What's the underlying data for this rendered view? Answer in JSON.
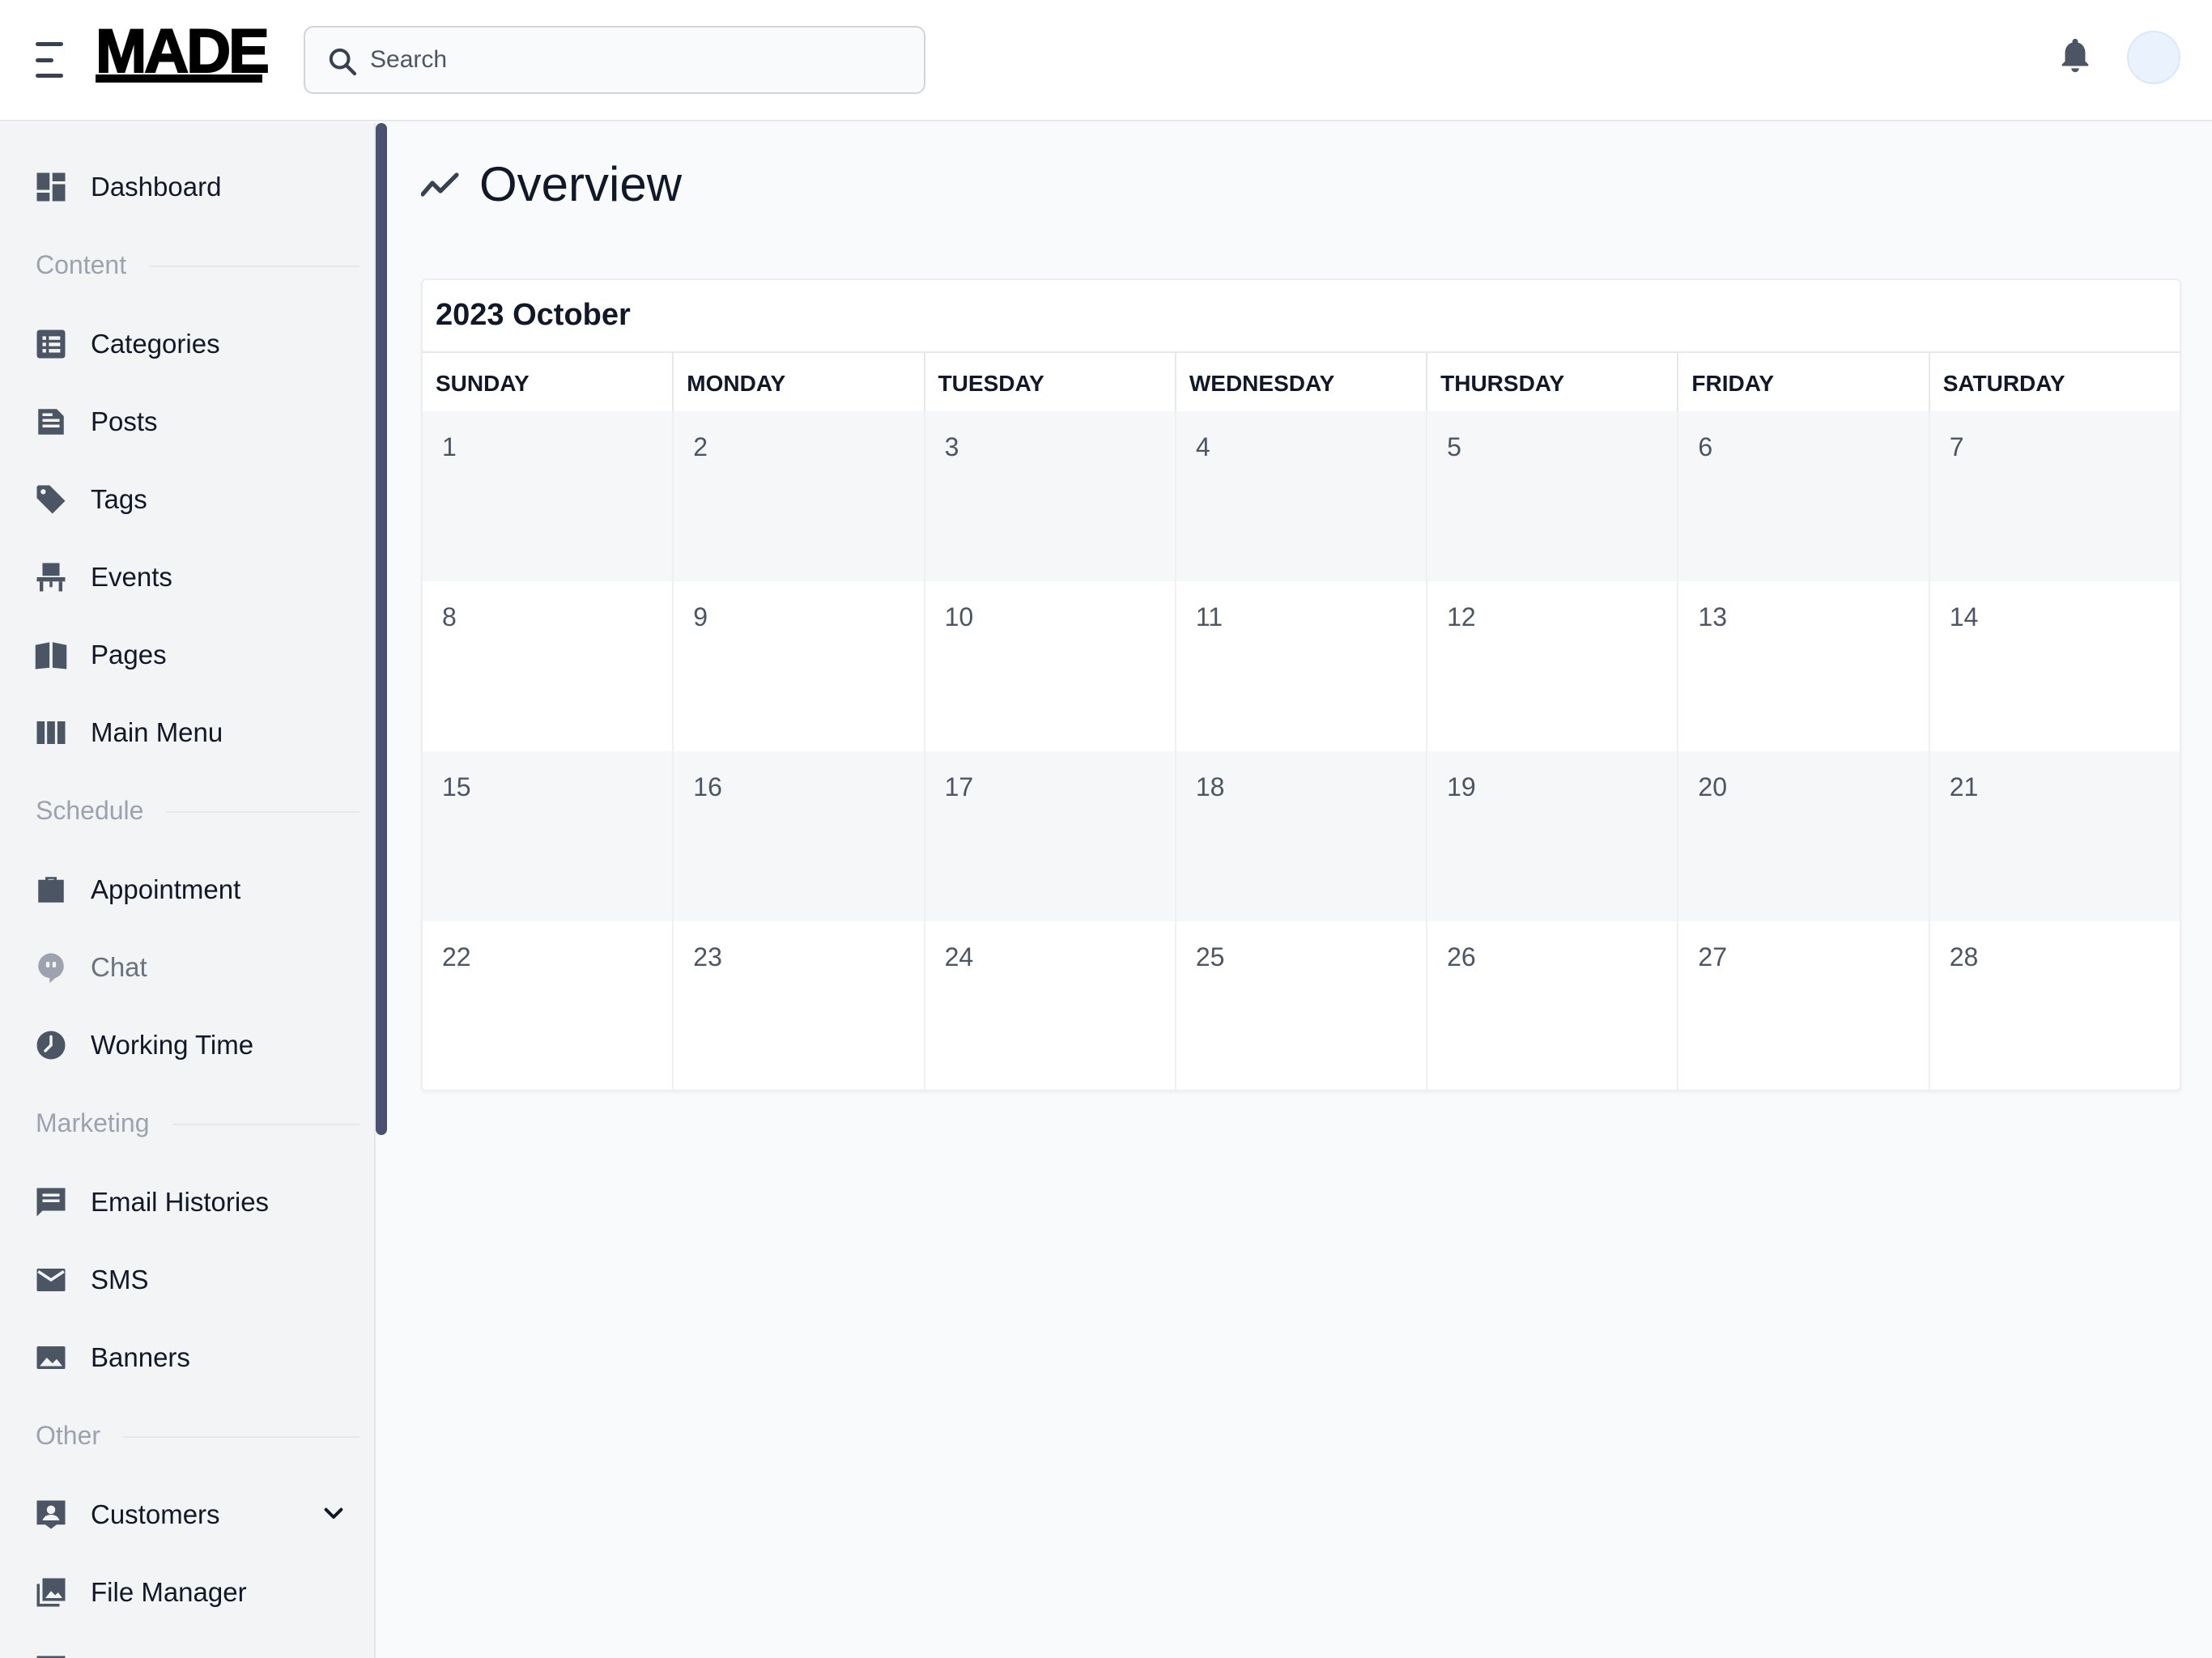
{
  "header": {
    "logo": "MADE",
    "search": {
      "placeholder": "Search",
      "value": ""
    }
  },
  "sidebar": {
    "dashboard": "Dashboard",
    "sections": {
      "content": "Content",
      "schedule": "Schedule",
      "marketing": "Marketing",
      "other": "Other"
    },
    "items": {
      "categories": "Categories",
      "posts": "Posts",
      "tags": "Tags",
      "events": "Events",
      "pages": "Pages",
      "main_menu": "Main Menu",
      "appointment": "Appointment",
      "chat": "Chat",
      "working_time": "Working Time",
      "email_histories": "Email Histories",
      "sms": "SMS",
      "banners": "Banners",
      "customers": "Customers",
      "file_manager": "File Manager"
    }
  },
  "main": {
    "title": "Overview",
    "calendar": {
      "title": "2023 October",
      "weekdays": [
        "SUNDAY",
        "MONDAY",
        "TUESDAY",
        "WEDNESDAY",
        "THURSDAY",
        "FRIDAY",
        "SATURDAY"
      ],
      "weeks": [
        [
          "1",
          "2",
          "3",
          "4",
          "5",
          "6",
          "7"
        ],
        [
          "8",
          "9",
          "10",
          "11",
          "12",
          "13",
          "14"
        ],
        [
          "15",
          "16",
          "17",
          "18",
          "19",
          "20",
          "21"
        ],
        [
          "22",
          "23",
          "24",
          "25",
          "26",
          "27",
          "28"
        ]
      ]
    }
  },
  "colors": {
    "sidebar_bg": "#f3f4f6",
    "main_bg": "#f9fafb",
    "scrollbar": "#4b5070",
    "text": "#111827",
    "muted": "#9ca3af"
  },
  "icons": {
    "menu": "hamburger-icon",
    "search": "search-icon",
    "notifications": "bell-icon",
    "dashboard": "dashboard-icon",
    "categories": "list-icon",
    "posts": "document-icon",
    "tags": "tag-icon",
    "events": "chair-icon",
    "pages": "book-icon",
    "main_menu": "columns-icon",
    "appointment": "briefcase-icon",
    "chat": "chat-icon",
    "working_time": "clock-icon",
    "email_histories": "message-icon",
    "sms": "envelope-icon",
    "banners": "image-icon",
    "customers": "contact-card-icon",
    "file_manager": "photo-library-icon",
    "overview": "trending-icon"
  }
}
